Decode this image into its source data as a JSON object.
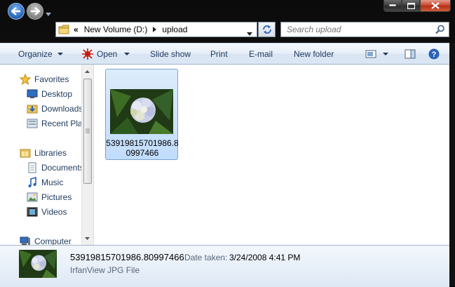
{
  "address": {
    "overflow": "«",
    "segments": [
      "New Volume (D:)",
      "upload"
    ]
  },
  "search": {
    "placeholder": "Search upload"
  },
  "toolbar": {
    "organize": "Organize",
    "open": "Open",
    "slideshow": "Slide show",
    "print": "Print",
    "email": "E-mail",
    "new_folder": "New folder"
  },
  "nav": {
    "favorites": {
      "label": "Favorites",
      "items": [
        "Desktop",
        "Downloads",
        "Recent Places"
      ]
    },
    "libraries": {
      "label": "Libraries",
      "items": [
        "Documents",
        "Music",
        "Pictures",
        "Videos"
      ]
    },
    "computer": "Computer"
  },
  "files": [
    {
      "name": "53919815701986.80997466",
      "selected": true
    }
  ],
  "details": {
    "name": "53919815701986.80997466",
    "date_label": "Date taken:",
    "date_value": "3/24/2008 4:41 PM",
    "type": "IrfanView JPG File"
  },
  "colors": {
    "accent": "#3a6ea5",
    "selection": "#c1dcfc",
    "toolbar": "#dce7f5"
  }
}
